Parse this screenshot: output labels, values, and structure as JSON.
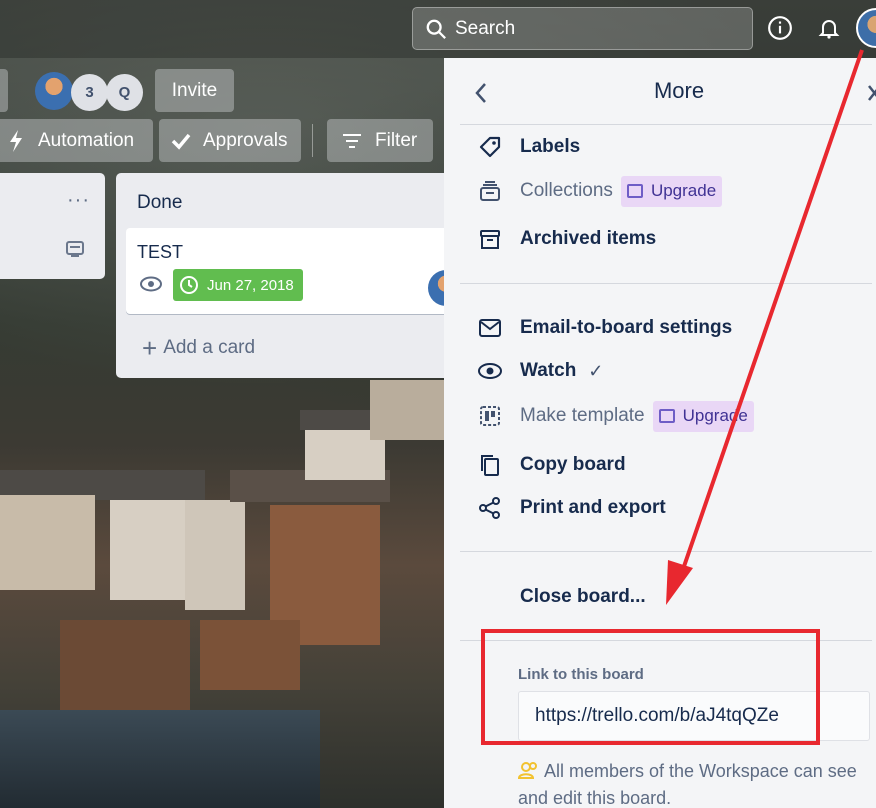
{
  "header": {
    "search_label": "Search"
  },
  "board": {
    "member_count": "3",
    "member_initial": "Q",
    "invite_label": "Invite",
    "automation_label": "Automation",
    "approvals_label": "Approvals",
    "filter_label": "Filter"
  },
  "lists": [
    {
      "title": "Done",
      "cards": [
        {
          "title": "TEST",
          "due": "Jun 27, 2018"
        }
      ],
      "add_label": "Add a card"
    }
  ],
  "panel": {
    "title": "More",
    "section1": [
      {
        "label": "Labels",
        "icon": "tag-icon"
      },
      {
        "label": "Collections",
        "icon": "collections-icon",
        "badge": "Upgrade"
      },
      {
        "label": "Archived items",
        "icon": "archive-icon"
      }
    ],
    "section2": [
      {
        "label": "Email-to-board settings",
        "icon": "email-icon"
      },
      {
        "label": "Watch",
        "icon": "eye-icon",
        "check": "✓"
      },
      {
        "label": "Make template",
        "icon": "template-icon",
        "badge": "Upgrade"
      },
      {
        "label": "Copy board",
        "icon": "copy-icon"
      },
      {
        "label": "Print and export",
        "icon": "share-icon"
      }
    ],
    "close_label": "Close board...",
    "link_label": "Link to this board",
    "link_value": "https://trello.com/b/aJ4tqQZe",
    "note": "All members of the Workspace can see and edit this board."
  },
  "colors": {
    "annotation": "#e8282f",
    "due_bg": "#61bd4f",
    "upgrade_bg": "#e9d7f6"
  }
}
